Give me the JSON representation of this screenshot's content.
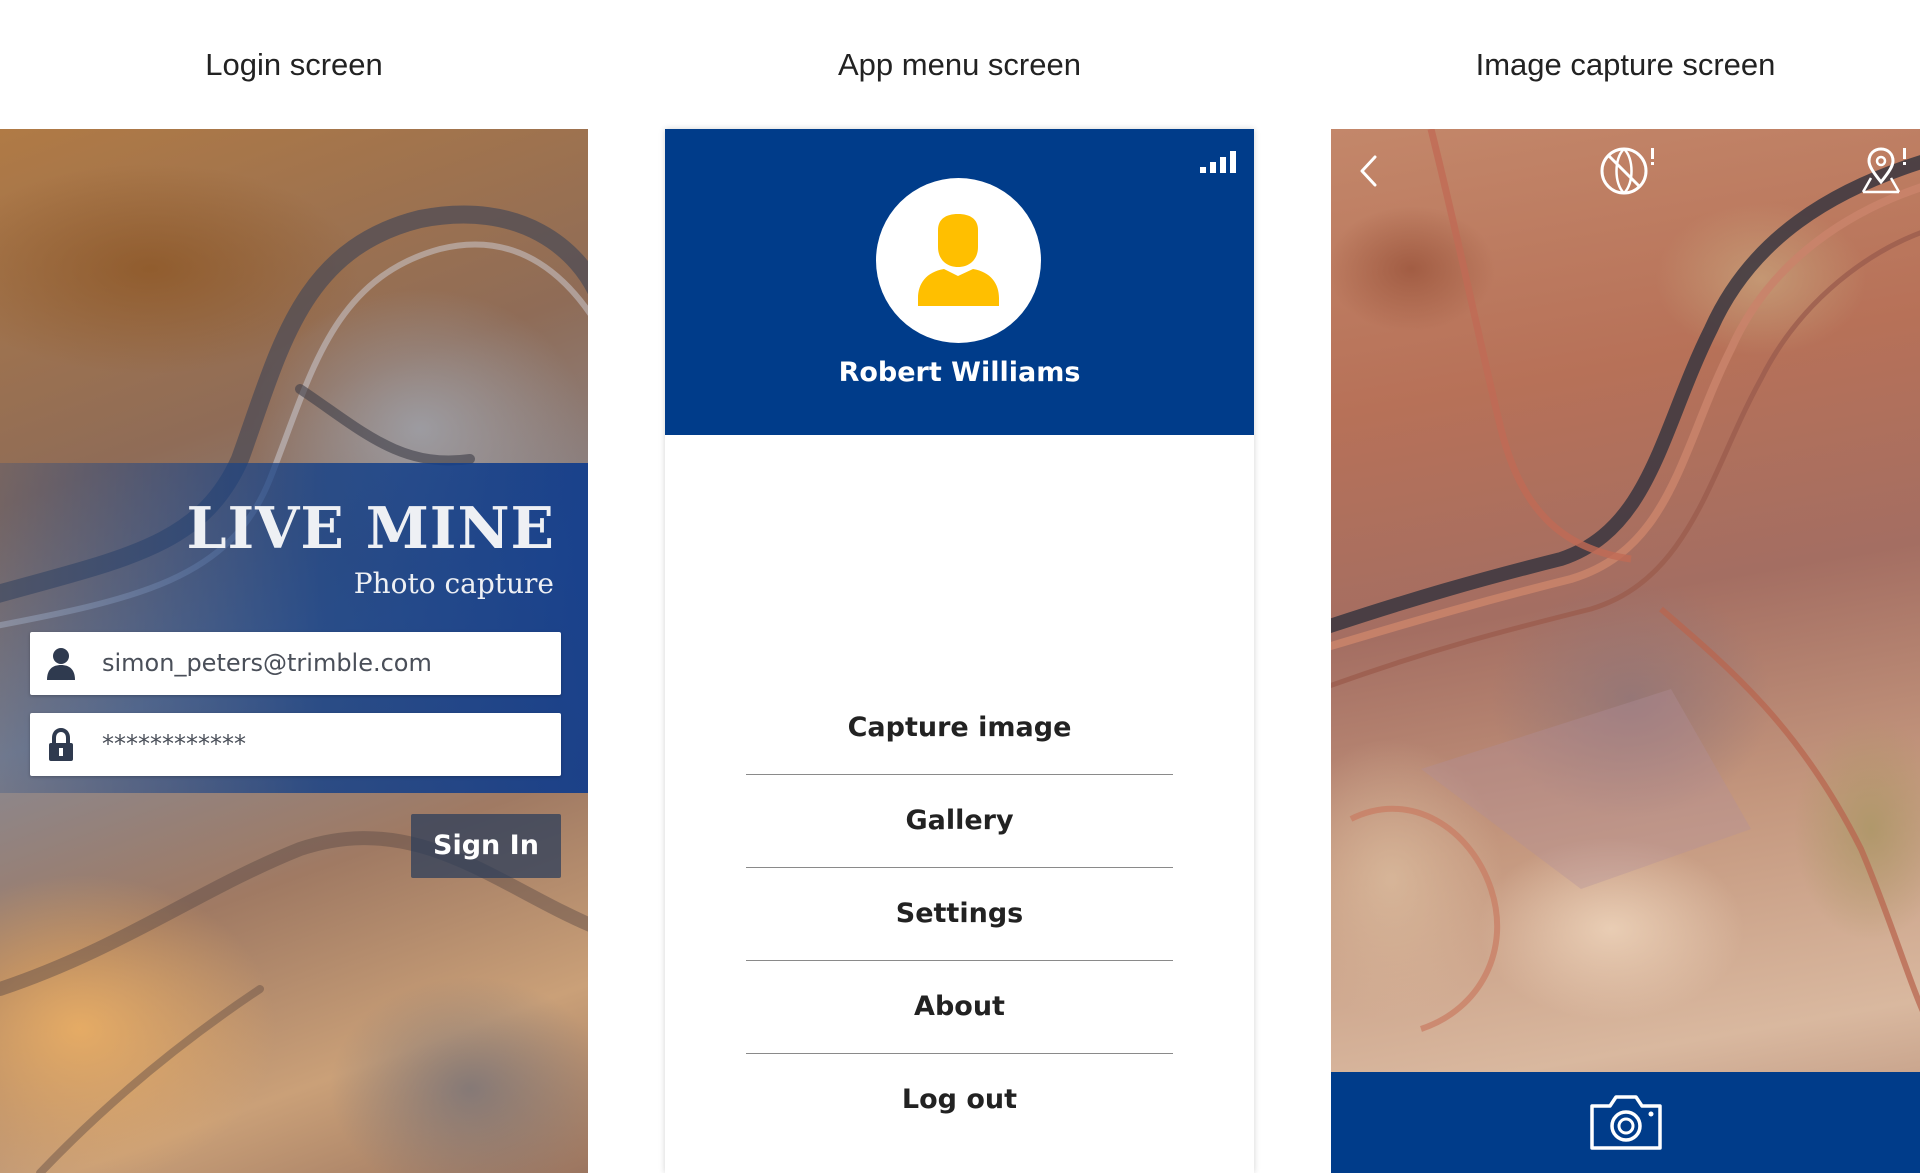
{
  "captions": {
    "login": "Login screen",
    "menu": "App menu screen",
    "capture": "Image capture screen"
  },
  "login": {
    "brand": "LIVE MINE",
    "tagline": "Photo capture",
    "username_value": "simon_peters@trimble.com",
    "password_value": "************",
    "signin_label": "Sign In",
    "icons": {
      "user": "user-icon",
      "lock": "lock-icon"
    },
    "accent_color": "#1e4b8f"
  },
  "menu": {
    "user_name": "Robert Williams",
    "items": [
      {
        "label": "Capture image"
      },
      {
        "label": "Gallery"
      },
      {
        "label": "Settings"
      },
      {
        "label": "About"
      },
      {
        "label": "Log out"
      }
    ],
    "header_color": "#003c8a",
    "avatar_color": "#ffbf00",
    "icons": {
      "signal": "signal-icon",
      "avatar": "avatar-icon"
    }
  },
  "capture": {
    "bar_color": "#003c8a",
    "icons": {
      "back": "back-chevron-icon",
      "gps": "gps-warning-icon",
      "location": "location-warning-icon",
      "camera": "camera-icon"
    }
  }
}
